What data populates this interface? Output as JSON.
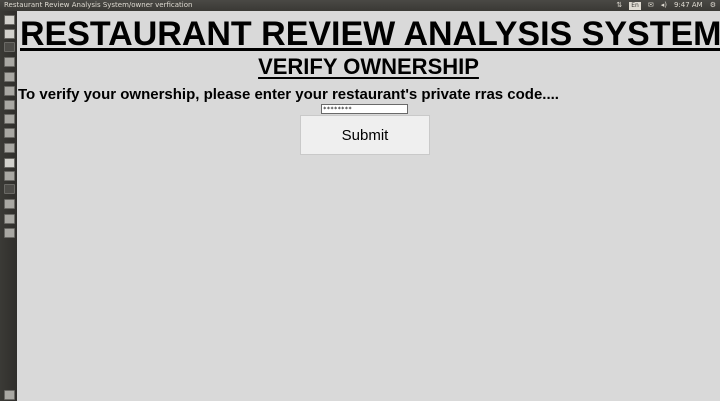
{
  "window": {
    "title": "Restaurant Review Analysis System/owner verfication"
  },
  "tray": {
    "keyboard_layout": "En",
    "clock": "9:47 AM",
    "icons": [
      "network-icon",
      "keyboard-layout-icon",
      "mail-icon",
      "volume-icon",
      "power-gear-icon"
    ]
  },
  "launcher": {
    "icons": [
      "dash-home-icon",
      "files-icon",
      "terminal-icon",
      "app-icon",
      "app-icon",
      "app-icon",
      "app-icon",
      "app-icon",
      "app-icon",
      "app-icon",
      "app-icon",
      "app-icon",
      "app-icon",
      "app-icon",
      "app-icon",
      "trash-icon"
    ]
  },
  "page": {
    "title": "RESTAURANT REVIEW ANALYSIS SYSTEM",
    "subtitle": "VERIFY OWNERSHIP",
    "instruction": "To verify your ownership, please enter your restaurant's private rras code....",
    "code_value": "********",
    "submit_label": "Submit"
  }
}
